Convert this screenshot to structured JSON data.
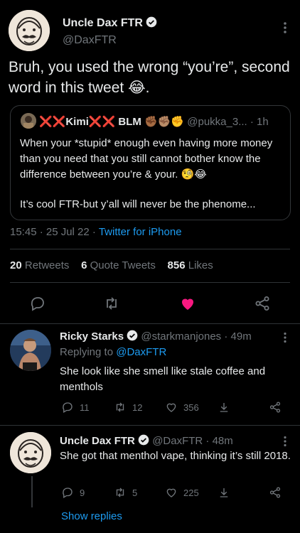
{
  "tweet": {
    "author_name": "Uncle Dax FTR",
    "author_handle": "@DaxFTR",
    "text": "Bruh, you used the wrong “you’re”, second word in this tweet 😂.",
    "timestamp": "15:45 · 25 Jul 22 · ",
    "source": "Twitter for iPhone",
    "retweets_count": "20",
    "retweets_label": " Retweets",
    "quotes_count": "6",
    "quotes_label": " Quote Tweets",
    "likes_count": "856",
    "likes_label": " Likes"
  },
  "quote": {
    "display_name": "❌❌Kimi❌❌ BLM ✊🏾✊🏽✊",
    "handle": "@pukka_3...",
    "time": " · 1h",
    "text_1": "When your *stupid* enough even having more money than you need that you still cannot bother know the difference between you’re & your. 🧐😂",
    "text_2": "It’s cool FTR-but y’all will never be the phenome..."
  },
  "replies": [
    {
      "author_name": "Ricky Starks",
      "handle_time": "@starkmanjones · 49m",
      "replying_prefix": "Replying to ",
      "replying_to": "@DaxFTR",
      "text": "She look like she smell like stale coffee and menthols",
      "reply_count": "11",
      "retweet_count": "12",
      "like_count": "356"
    },
    {
      "author_name": "Uncle Dax FTR",
      "handle_time": "@DaxFTR · 48m",
      "text": "She got that menthol vape, thinking it’s still 2018.",
      "reply_count": "9",
      "retweet_count": "5",
      "like_count": "225"
    }
  ],
  "show_replies": "Show replies",
  "colors": {
    "accent": "#1d9bf0",
    "like": "#f91880",
    "background": "#000000",
    "muted": "#71767b"
  },
  "icons": [
    "verified-icon",
    "more-icon",
    "reply-icon",
    "retweet-icon",
    "like-icon",
    "share-icon",
    "download-icon"
  ]
}
